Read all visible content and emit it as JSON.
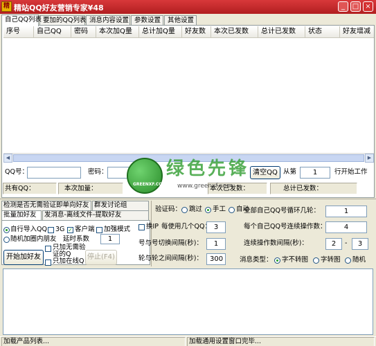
{
  "window": {
    "title": "精站QQ好友营销专家¥48",
    "icon_glyph": "精",
    "controls": {
      "minimize": "_",
      "maximize": "□",
      "close": "×"
    }
  },
  "tabs": [
    "自己QQ列表",
    "要加的QQ列表",
    "消息内容设置",
    "参数设置",
    "其他设置"
  ],
  "grid": {
    "columns": [
      "序号",
      "自己QQ",
      "密码",
      "本次加Q量",
      "总计加Q量",
      "好友数",
      "本次已发数",
      "总计已发数",
      "状态",
      "好友增减"
    ]
  },
  "account": {
    "qq_label": "QQ号：",
    "qq_value": "",
    "password_label": "密码：",
    "password_value": "",
    "clear_button": "清空QQ",
    "from_label": "从第",
    "from_value": "1",
    "start_label": "行开始工作"
  },
  "stats": {
    "total_qq_label": "共有QQ：",
    "this_add_label": "本次加量：",
    "this_sent_label": "本次已发数：",
    "total_sent_label": "总计已发数："
  },
  "left_tabs": {
    "row1": [
      "检测是否无需验证即单向好友",
      "群发讨论组"
    ],
    "row2": [
      "批量加好友",
      "发消息-离线文件-提取好友"
    ]
  },
  "left_panel": {
    "auto_import": "自行导入QQ",
    "opt_3g": "3G",
    "opt_client": "客户端",
    "opt_boost": "加强模式",
    "random_group": "随机加圈内朋友",
    "only_no_verify": "只加无需验证的Q",
    "only_online": "只加在线Q",
    "delay_label": "延时系数",
    "delay_value": "1",
    "start_button": "开始加好友",
    "stop_button": "停止(F4)"
  },
  "middle": {
    "verify_label": "验证码：",
    "verify_options": [
      "跳过",
      "手工",
      "自动"
    ],
    "verify_selected": 1,
    "change_ip": "换IP",
    "per_qq_label": "每使用几个QQ：",
    "per_qq_value": "3",
    "qq_interval_label": "号与号切换间隔(秒)：",
    "qq_interval_value": "1",
    "round_interval_label": "轮与轮之间间隔(秒)：",
    "round_interval_value": "300"
  },
  "right": {
    "cycle_label": "全部自己QQ号循环几轮：",
    "cycle_value": "1",
    "consecutive_label": "每个自己QQ号连续操作数：",
    "consecutive_value": "4",
    "op_interval_label": "连续操作数间隔(秒)：",
    "op_interval_from": "2",
    "op_interval_sep": "-",
    "op_interval_to": "3",
    "msg_type_label": "消息类型：",
    "msg_types": [
      "字不转图",
      "字转图",
      "随机"
    ],
    "msg_type_selected": 0
  },
  "log": {
    "text": ""
  },
  "status": {
    "left": "加载产品列表...",
    "right": "加载通用设置窗口完毕..."
  },
  "watermark": {
    "brand": "绿色先锋",
    "logo_text": "GREENXF.COM",
    "url": "www.greenxf.com"
  }
}
